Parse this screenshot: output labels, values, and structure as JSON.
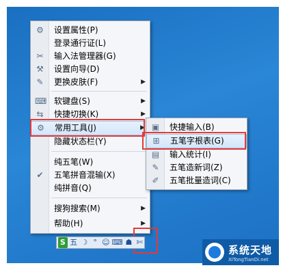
{
  "main_menu": {
    "items": [
      {
        "label": "设置属性(P)",
        "icon": "gear-icon",
        "glyph": "⚙"
      },
      {
        "label": "登录通行证(L)",
        "icon": "",
        "glyph": ""
      },
      {
        "label": "输入法管理器(G)",
        "icon": "wrench-icon",
        "glyph": "✂"
      },
      {
        "label": "设置向导(D)",
        "icon": "wand-icon",
        "glyph": "⚒"
      },
      {
        "label": "更换皮肤(F)",
        "icon": "brush-icon",
        "glyph": "✎",
        "arrow": "▶"
      },
      {
        "label": "软键盘(S)",
        "icon": "keyboard-icon",
        "glyph": "⌨",
        "arrow": "▶"
      },
      {
        "label": "快捷切换(K)",
        "icon": "switch-icon",
        "glyph": "⇆",
        "arrow": "▶"
      },
      {
        "label": "常用工具(J)",
        "icon": "tools-icon",
        "glyph": "⚙",
        "arrow": "▶"
      },
      {
        "label": "隐藏状态栏(Y)",
        "icon": "",
        "glyph": ""
      },
      {
        "label": "纯五笔(W)",
        "icon": "",
        "glyph": ""
      },
      {
        "label": "五笔拼音混输(X)",
        "icon": "check-icon",
        "glyph": "✔"
      },
      {
        "label": "纯拼音(Q)",
        "icon": "",
        "glyph": ""
      },
      {
        "label": "搜狗搜索(M)",
        "icon": "",
        "glyph": "",
        "arrow": "▶"
      },
      {
        "label": "帮助(H)",
        "icon": "",
        "glyph": "",
        "arrow": "▶"
      }
    ]
  },
  "sub_menu": {
    "items": [
      {
        "label": "快捷输入(B)",
        "icon": "quick-input-icon",
        "glyph": "▣"
      },
      {
        "label": "五笔字根表(G)",
        "icon": "radical-table-icon",
        "glyph": "⊞"
      },
      {
        "label": "输入统计(I)",
        "icon": "stats-icon",
        "glyph": "▤"
      },
      {
        "label": "五笔造新词(Z)",
        "icon": "new-word-icon",
        "glyph": "✎"
      },
      {
        "label": "五笔批量造词(C)",
        "icon": "batch-word-icon",
        "glyph": "✐"
      }
    ]
  },
  "toolbar": {
    "logo": "S",
    "mode": "五",
    "moon": "☽",
    "dot": "°",
    "smile": "☺",
    "keyboard": "⌨",
    "person": "☗",
    "wrench": "✄"
  },
  "watermark": {
    "title": "系统天地",
    "subtitle": "XiTongTianDi.net"
  },
  "colors": {
    "highlight_border": "#e53935",
    "desktop": "#1a6fc0"
  }
}
